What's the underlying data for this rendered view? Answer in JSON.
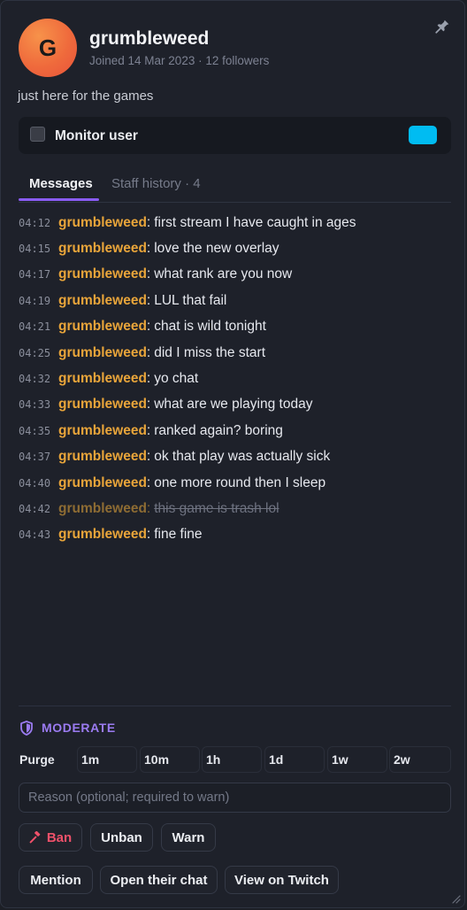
{
  "profile": {
    "avatar_letter": "G",
    "username": "grumbleweed",
    "joined": "Joined 14 Mar 2023 · 12 followers",
    "bio": "just here for the games"
  },
  "monitor": {
    "label": "Monitor user",
    "checked": false,
    "color": "#00bcf2"
  },
  "tabs": [
    {
      "label": "Messages",
      "active": true
    },
    {
      "label": "Staff history · 4",
      "active": false
    }
  ],
  "messages": [
    {
      "time": "04:12",
      "user": "grumbleweed",
      "text": "first stream I have caught in ages",
      "deleted": false
    },
    {
      "time": "04:15",
      "user": "grumbleweed",
      "text": "love the new overlay",
      "deleted": false
    },
    {
      "time": "04:17",
      "user": "grumbleweed",
      "text": "what rank are you now",
      "deleted": false
    },
    {
      "time": "04:19",
      "user": "grumbleweed",
      "text": "LUL that fail",
      "deleted": false
    },
    {
      "time": "04:21",
      "user": "grumbleweed",
      "text": "chat is wild tonight",
      "deleted": false
    },
    {
      "time": "04:25",
      "user": "grumbleweed",
      "text": "did I miss the start",
      "deleted": false
    },
    {
      "time": "04:32",
      "user": "grumbleweed",
      "text": "yo chat",
      "deleted": false
    },
    {
      "time": "04:33",
      "user": "grumbleweed",
      "text": "what are we playing today",
      "deleted": false
    },
    {
      "time": "04:35",
      "user": "grumbleweed",
      "text": "ranked again? boring",
      "deleted": false
    },
    {
      "time": "04:37",
      "user": "grumbleweed",
      "text": "ok that play was actually sick",
      "deleted": false
    },
    {
      "time": "04:40",
      "user": "grumbleweed",
      "text": "one more round then I sleep",
      "deleted": false
    },
    {
      "time": "04:42",
      "user": "grumbleweed",
      "text": "this game is trash lol",
      "deleted": true
    },
    {
      "time": "04:43",
      "user": "grumbleweed",
      "text": "fine fine",
      "deleted": false
    }
  ],
  "moderate": {
    "title": "MODERATE",
    "durations": [
      "Purge",
      "1m",
      "10m",
      "1h",
      "1d",
      "1w",
      "2w"
    ],
    "reason_placeholder": "Reason (optional; required to warn)",
    "ban": "Ban",
    "unban": "Unban",
    "warn": "Warn"
  },
  "actions": {
    "mention": "Mention",
    "open_chat": "Open their chat",
    "view_twitch": "View on Twitch"
  },
  "colors": {
    "accent": "#8a5cf6",
    "username": "#e9a53a",
    "ban": "#f0516a"
  }
}
